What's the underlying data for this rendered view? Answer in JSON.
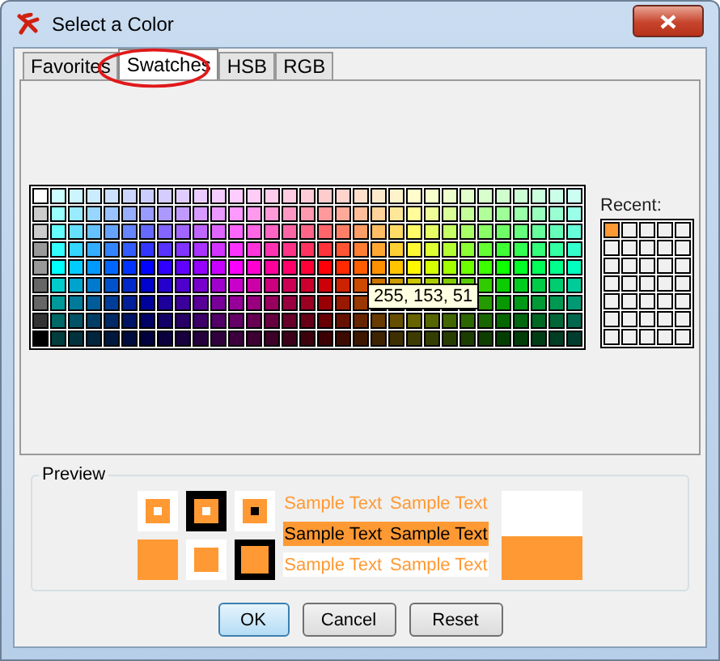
{
  "window": {
    "title": "Select a Color"
  },
  "tabs": [
    {
      "label": "Favorites",
      "selected": false
    },
    {
      "label": "Swatches",
      "selected": true
    },
    {
      "label": "HSB",
      "selected": false
    },
    {
      "label": "RGB",
      "selected": false
    }
  ],
  "swatches": {
    "tooltip": "255, 153, 51"
  },
  "recent": {
    "label": "Recent:",
    "items": [
      {
        "color": "#ff9933"
      }
    ]
  },
  "preview": {
    "title": "Preview",
    "color": "#ff9933",
    "sample_rows": [
      {
        "kind": "plain",
        "texts": [
          "Sample Text",
          "Sample Text"
        ]
      },
      {
        "kind": "filled",
        "texts": [
          "Sample Text",
          "Sample Text"
        ]
      },
      {
        "kind": "on-white",
        "texts": [
          "Sample Text",
          "Sample Text"
        ]
      }
    ]
  },
  "buttons": [
    {
      "label": "OK",
      "default": true
    },
    {
      "label": "Cancel",
      "default": false
    },
    {
      "label": "Reset",
      "default": false
    }
  ]
}
